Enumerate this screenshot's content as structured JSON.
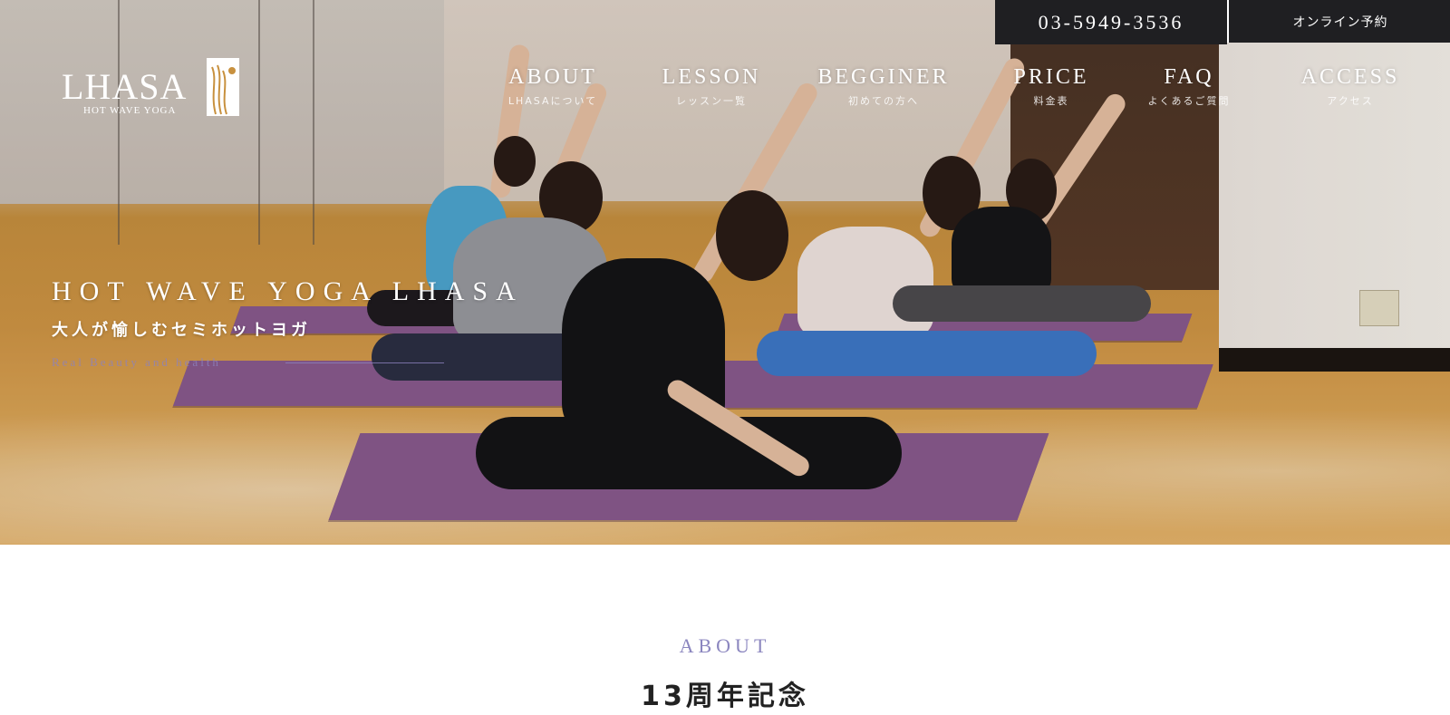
{
  "header": {
    "logo": {
      "name": "LHASA",
      "subtitle": "HOT WAVE YOGA"
    },
    "phone": "03-5949-3536",
    "reserve_label": "オンライン予約"
  },
  "nav": [
    {
      "en": "ABOUT",
      "ja": "LHASAについて"
    },
    {
      "en": "LESSON",
      "ja": "レッスン一覧"
    },
    {
      "en": "BEGGINER",
      "ja": "初めての方へ"
    },
    {
      "en": "PRICE",
      "ja": "料金表"
    },
    {
      "en": "FAQ",
      "ja": "よくあるご質問"
    },
    {
      "en": "ACCESS",
      "ja": "アクセス"
    }
  ],
  "hero": {
    "title": "HOT WAVE YOGA LHASA",
    "subtitle": "大人が愉しむセミホットヨガ",
    "tagline": "Real Beauty and health"
  },
  "about": {
    "label": "ABOUT",
    "title": "13周年記念"
  },
  "colors": {
    "accent": "#8b86bf",
    "dark_bar": "#1f1f22"
  }
}
